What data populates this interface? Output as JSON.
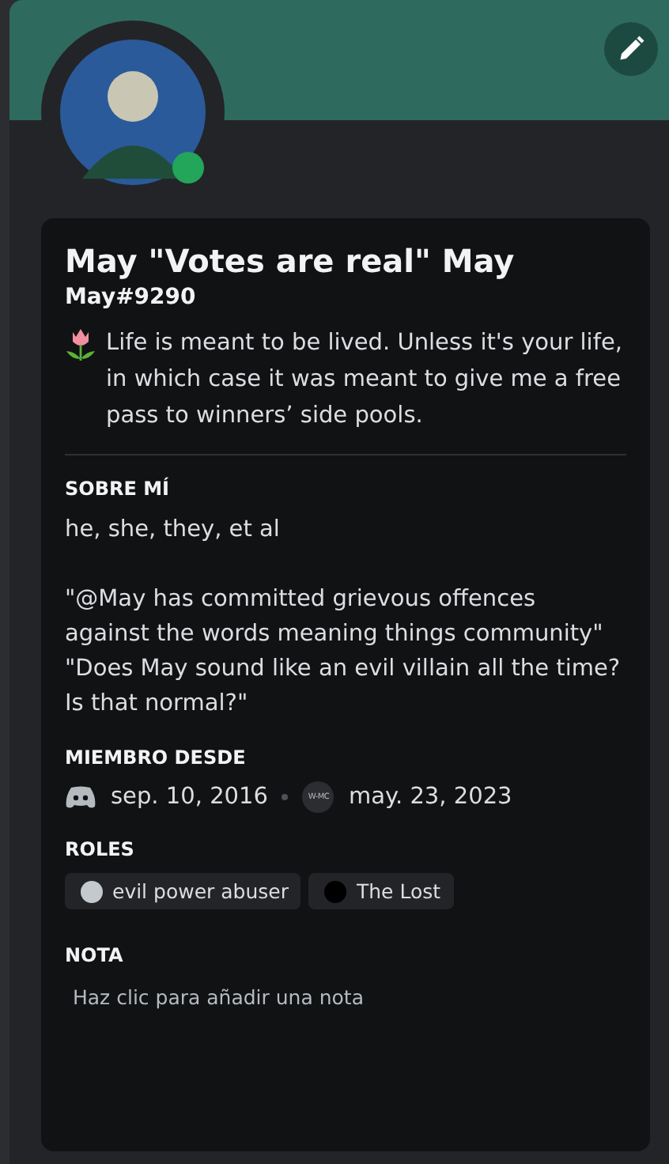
{
  "banner": {
    "color": "#2e6b5e"
  },
  "avatar": {
    "online": true
  },
  "profile": {
    "display_name": "May \"Votes are real\" May",
    "username": "May#9290",
    "bio": "Life is meant to be lived. Unless it's your life, in which case it was meant to give me a free pass to winners’ side pools."
  },
  "about": {
    "heading": "SOBRE MÍ",
    "paragraphs": [
      "he, she, they, et al",
      "\"@May has committed grievous offences against the words meaning things community\" \"Does May sound like an evil villain all the time? Is that normal?\""
    ]
  },
  "member_since": {
    "heading": "MIEMBRO DESDE",
    "discord_date": "sep. 10, 2016",
    "server_icon_label": "W-MC",
    "server_date": "may. 23, 2023"
  },
  "roles": {
    "heading": "ROLES",
    "items": [
      {
        "name": "evil power abuser",
        "color": "#c4c9ce"
      },
      {
        "name": "The Lost",
        "color": "#000000"
      }
    ]
  },
  "note": {
    "heading": "NOTA",
    "placeholder": "Haz clic para añadir una nota"
  }
}
